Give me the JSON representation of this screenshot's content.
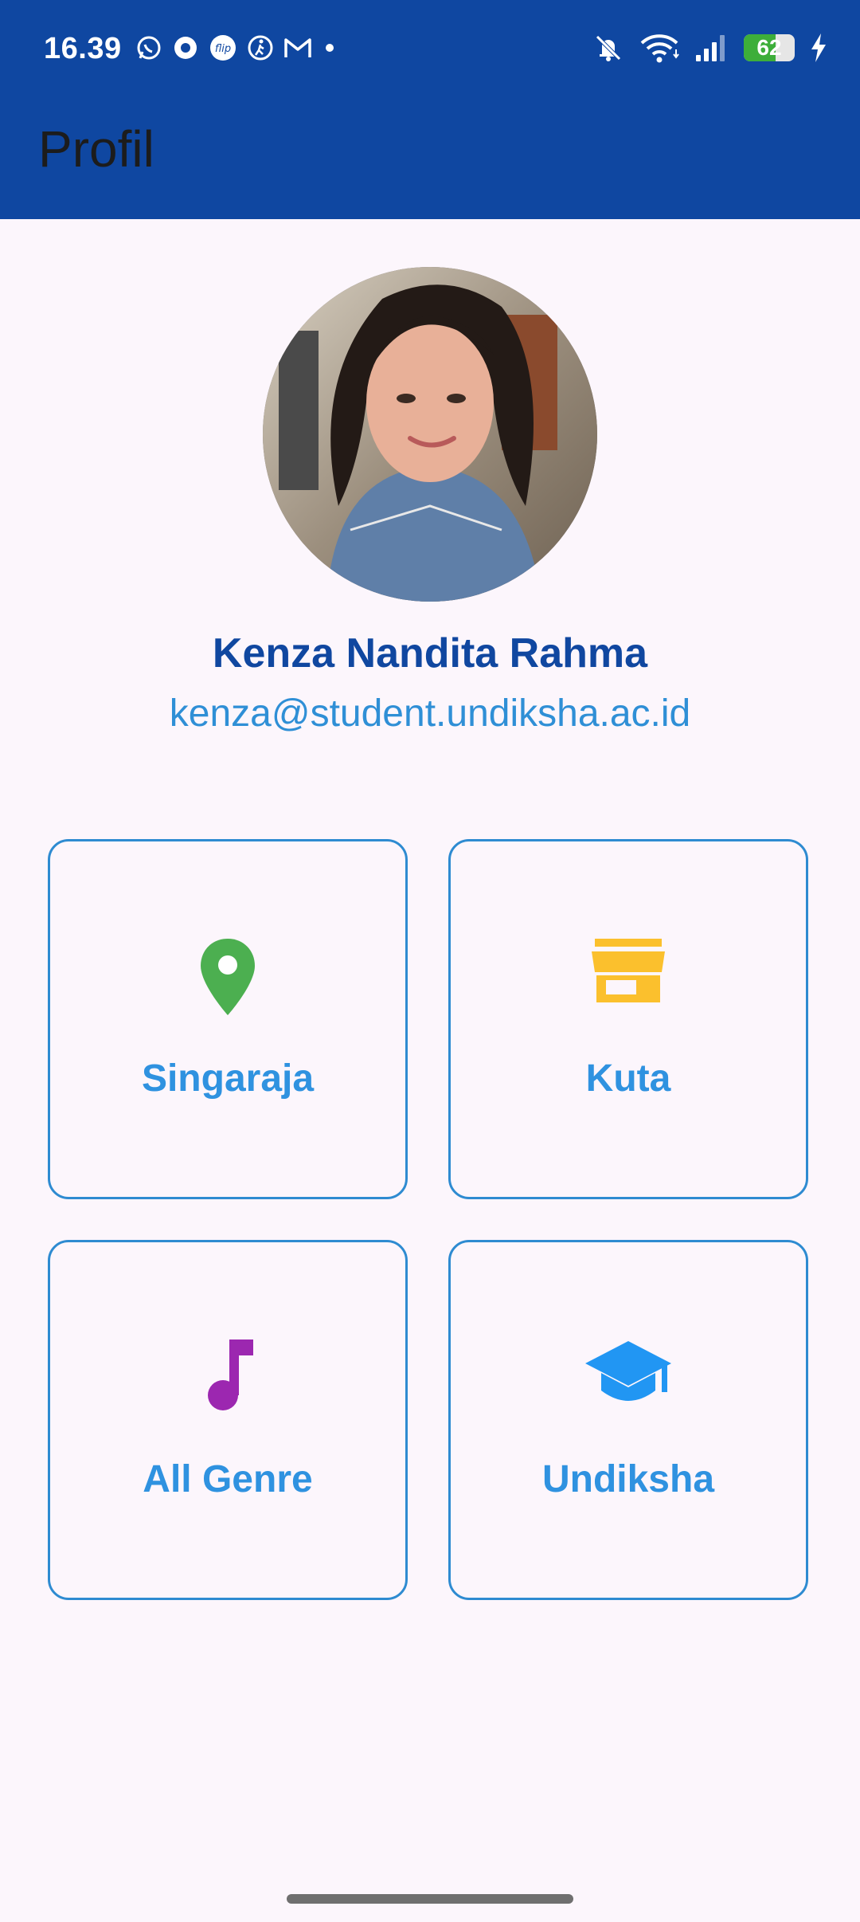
{
  "status_bar": {
    "time": "16.39",
    "battery_level": "62",
    "battery_fraction": 0.62
  },
  "app_bar": {
    "title": "Profil"
  },
  "profile": {
    "name": "Kenza Nandita Rahma",
    "email": "kenza@student.undiksha.ac.id"
  },
  "cards": [
    {
      "label": "Singaraja",
      "icon": "location-pin-icon",
      "color": "#4caf50"
    },
    {
      "label": "Kuta",
      "icon": "store-icon",
      "color": "#fbc02d"
    },
    {
      "label": "All Genre",
      "icon": "music-note-icon",
      "color": "#9c27b0"
    },
    {
      "label": "Undiksha",
      "icon": "graduation-cap-icon",
      "color": "#2196f3"
    }
  ],
  "colors": {
    "app_bar": "#0f47a1",
    "background": "#fcf6fc",
    "name_text": "#1047a0",
    "email_text": "#2f8fd6",
    "card_border": "#2e8bd1",
    "card_label": "#2f92e0"
  }
}
